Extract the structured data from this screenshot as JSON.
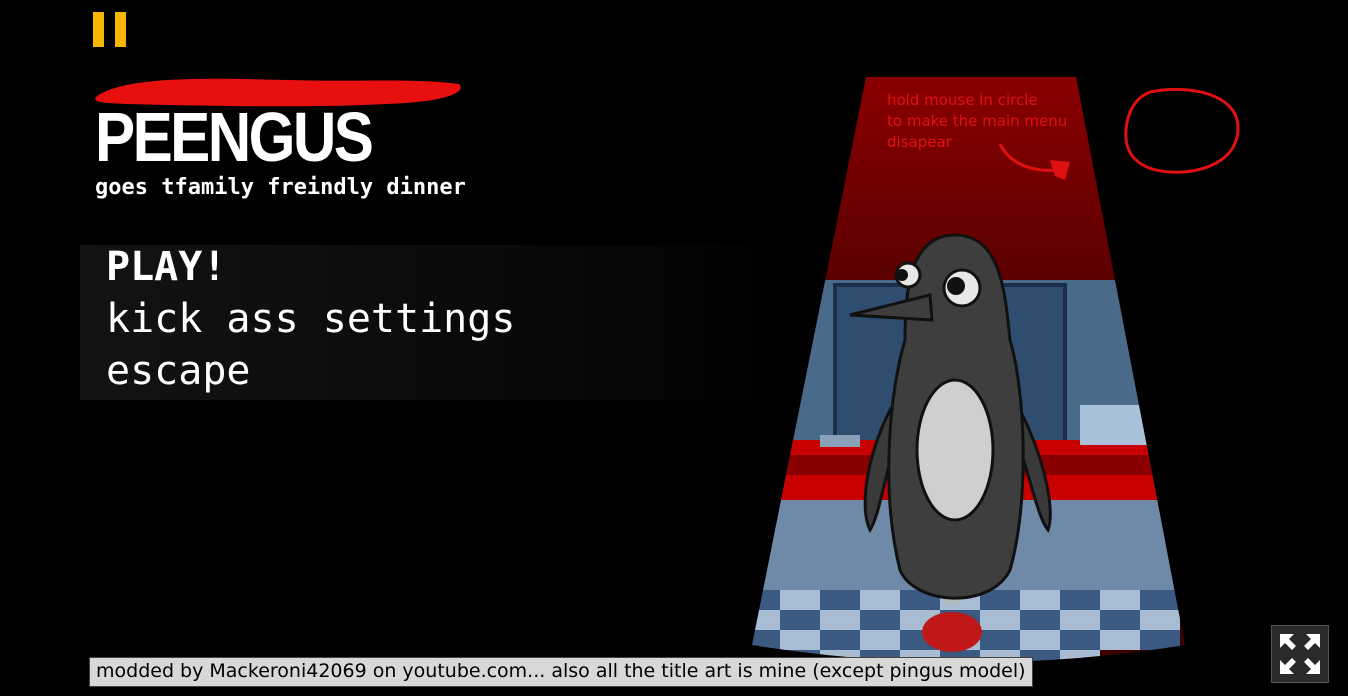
{
  "title": {
    "main": "PEENGUS",
    "subtitle_prefix": "goes t",
    "subtitle_scribble": "family freindly d",
    "subtitle_suffix": "inner"
  },
  "menu": {
    "items": [
      "PLAY!",
      "kick ass settings",
      "escape"
    ]
  },
  "hint": {
    "lines": [
      "hold mouse in circle",
      "to make the main menu",
      "disapear"
    ]
  },
  "footer": {
    "credit": "modded by Mackeroni42069 on youtube.com... also all the title art is mine (except pingus model)"
  },
  "icons": {
    "pause": "pause-icon",
    "fullscreen": "fullscreen-icon"
  },
  "colors": {
    "pause": "#f5b700",
    "hint": "#e01010",
    "scribble": "#e80f0f"
  }
}
